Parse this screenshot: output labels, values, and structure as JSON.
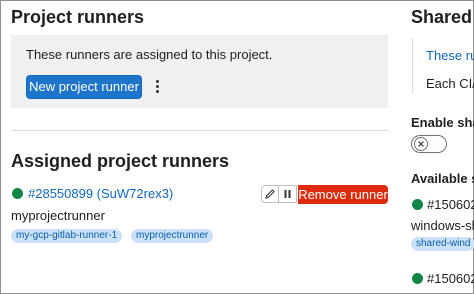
{
  "left": {
    "project_runners_title": "Project runners",
    "info_text": "These runners are assigned to this project.",
    "new_runner_button": "New project runner",
    "assigned_title": "Assigned project runners",
    "runner": {
      "link": "#28550899 (SuW72rex3)",
      "name": "myprojectrunner",
      "tags": [
        "my-gcp-gitlab-runner-1",
        "myprojectrunner"
      ],
      "status_color": "#108548",
      "edit_icon": "pencil-icon",
      "pause_icon": "pause-icon",
      "remove_button": "Remove runner"
    }
  },
  "right": {
    "shared_title": "Shared r",
    "info_link": "These run",
    "info_text": "Each CI/C",
    "enable_label": "Enable shar",
    "toggle_state": "off",
    "available_label": "Available sh",
    "runner1_link": "#150602",
    "runner1_name": "windows-sh",
    "runner1_tag": "shared-wind",
    "runner2_link": "#150602"
  },
  "colors": {
    "primary": "#1f75cb",
    "danger": "#dd2b0e",
    "success": "#108548",
    "link": "#1068bf"
  }
}
